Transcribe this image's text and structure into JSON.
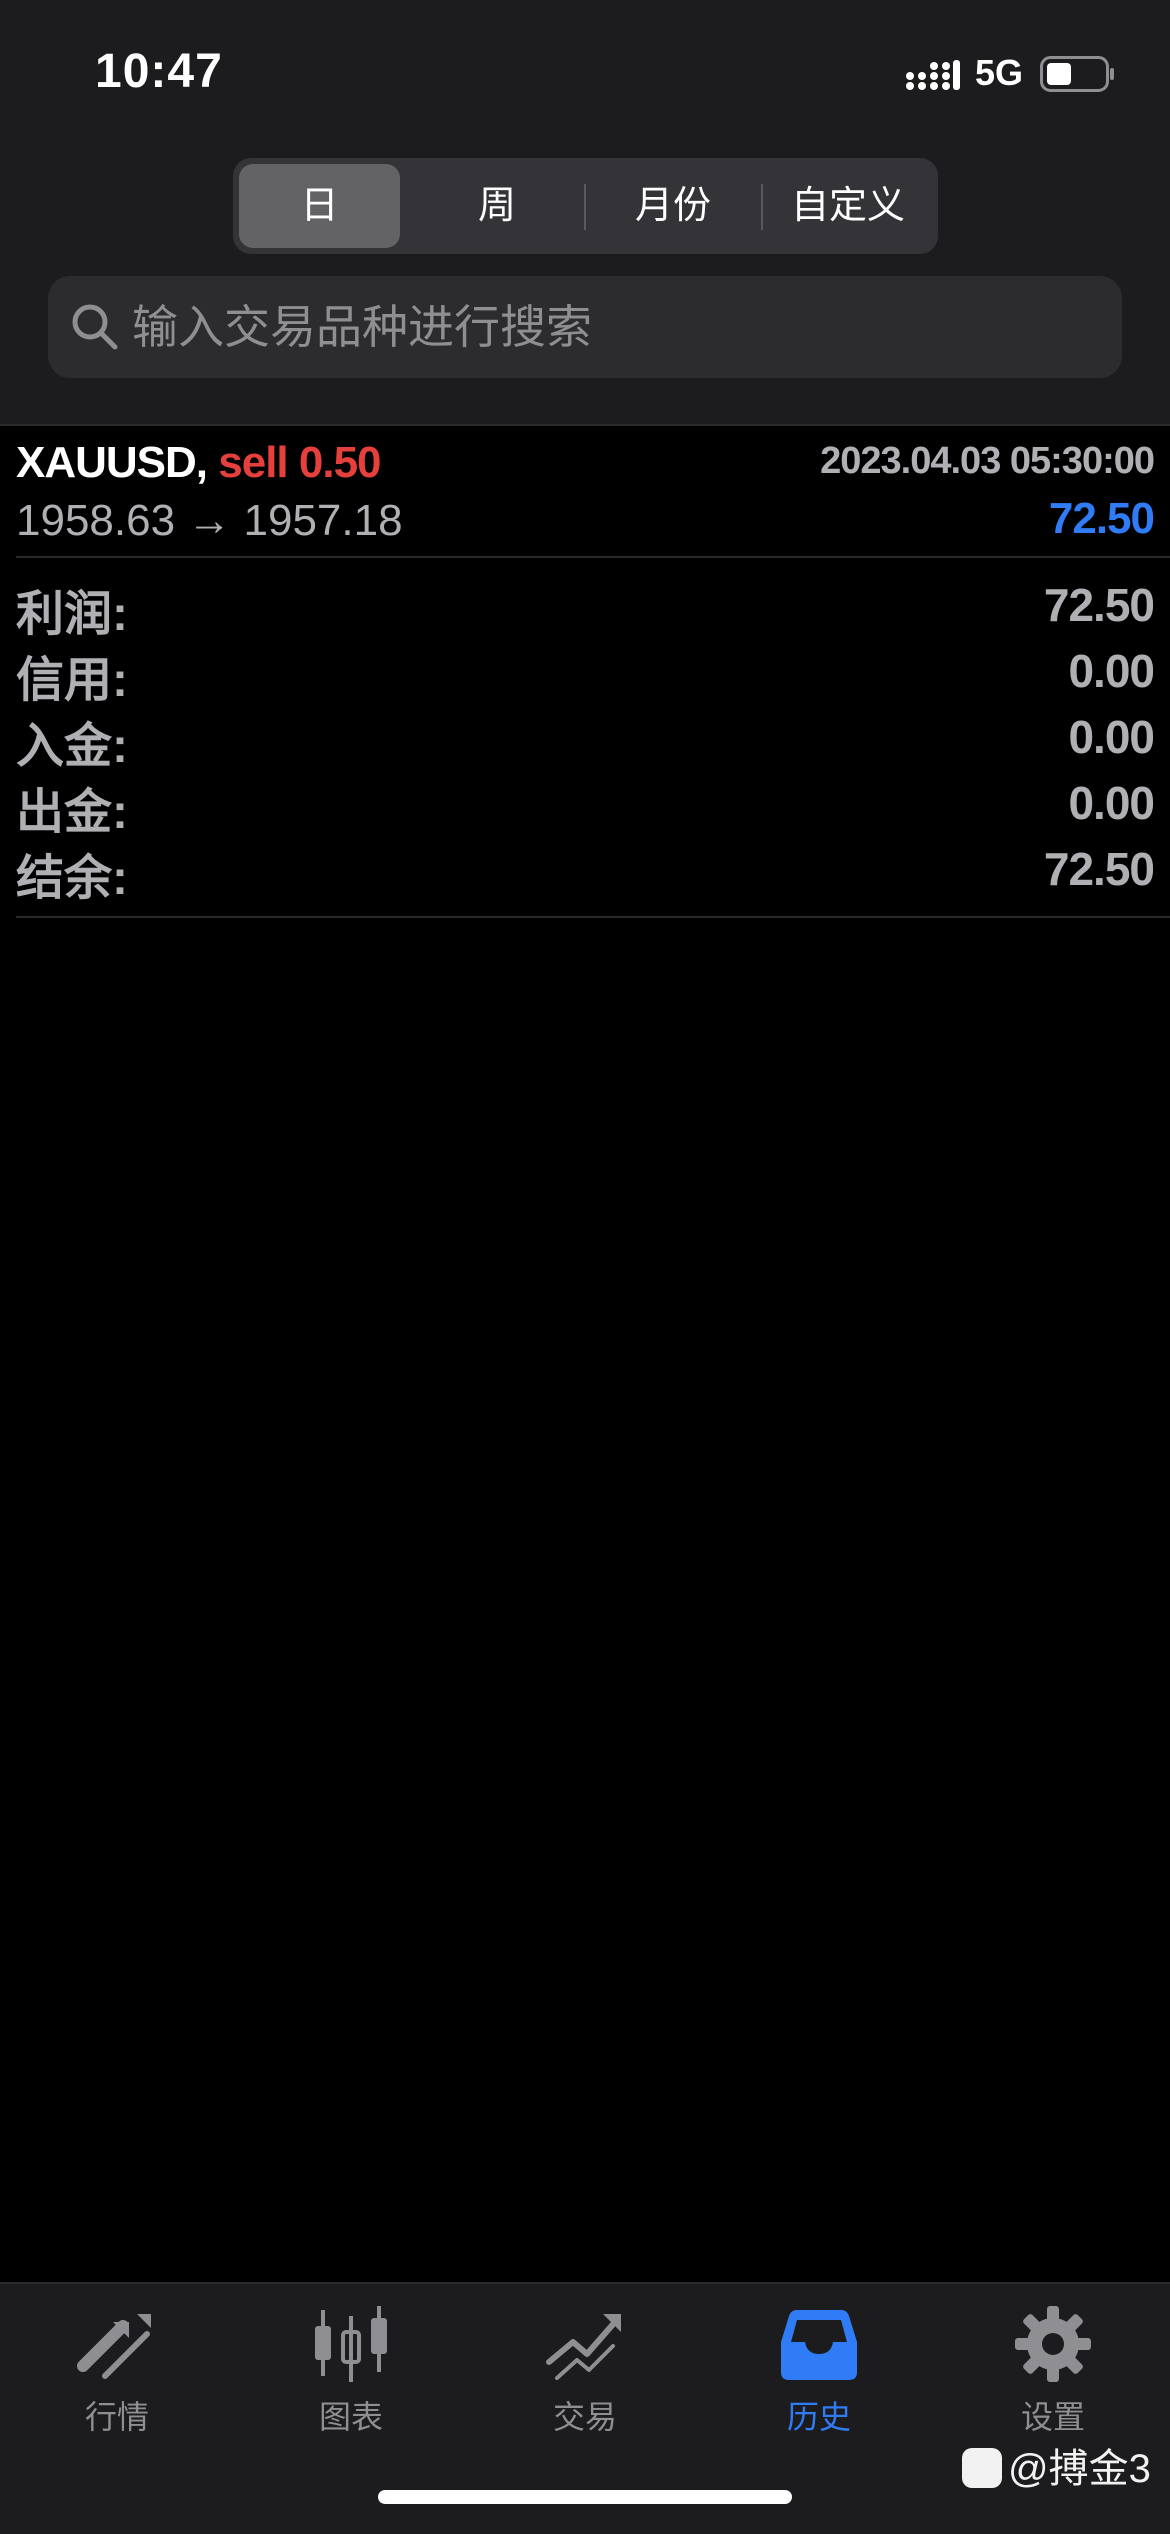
{
  "status_bar": {
    "time": "10:47",
    "network": "5G"
  },
  "segments": {
    "items": [
      {
        "label": "日",
        "active": true
      },
      {
        "label": "周",
        "active": false
      },
      {
        "label": "月份",
        "active": false
      },
      {
        "label": "自定义",
        "active": false
      }
    ]
  },
  "search": {
    "placeholder": "输入交易品种进行搜索",
    "value": ""
  },
  "deal": {
    "symbol": "XAUUSD,",
    "side": "sell 0.50",
    "time": "2023.04.03 05:30:00",
    "prices": "1958.63 → 1957.18",
    "profit": "72.50"
  },
  "summary": [
    {
      "label": "利润:",
      "value": "72.50"
    },
    {
      "label": "信用:",
      "value": "0.00"
    },
    {
      "label": "入金:",
      "value": "0.00"
    },
    {
      "label": "出金:",
      "value": "0.00"
    },
    {
      "label": "结余:",
      "value": "72.50"
    }
  ],
  "tabbar": {
    "items": [
      {
        "label": "行情",
        "icon": "quotes-icon",
        "active": false
      },
      {
        "label": "图表",
        "icon": "chart-icon",
        "active": false
      },
      {
        "label": "交易",
        "icon": "trade-icon",
        "active": false
      },
      {
        "label": "历史",
        "icon": "history-icon",
        "active": true
      },
      {
        "label": "设置",
        "icon": "gear-icon",
        "active": false
      }
    ]
  },
  "watermark": {
    "text": "@搏金3"
  },
  "colors": {
    "accent": "#2f7cf6",
    "sell": "#e6403d",
    "muted": "#8e8e93"
  }
}
